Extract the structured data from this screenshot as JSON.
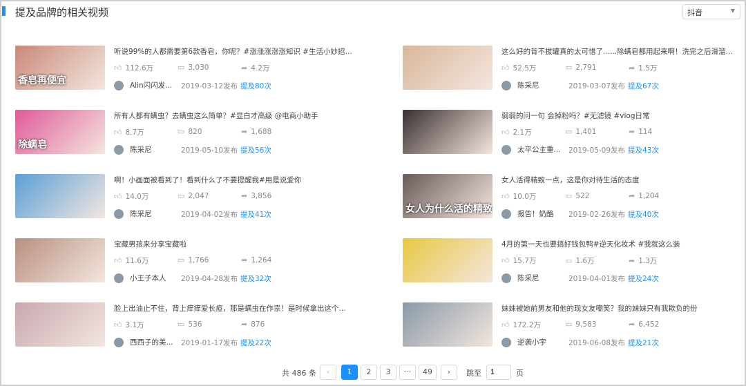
{
  "header": {
    "title": "提及品牌的相关视频",
    "platform": "抖音"
  },
  "videos": [
    {
      "title": "听说99%的人都需要第6款香皂，你呢？#涨涨涨涨涨知识 #生活小妙招 ...",
      "likes": "112.6万",
      "comments": "3,030",
      "shares": "4.2万",
      "author": "Alin闪闪发...",
      "date": "2019-03-12发布",
      "mentions": "提及80次",
      "caption": "香皂再便宜",
      "color": "#c9897a"
    },
    {
      "title": "这么好的背不拔罐真的太可惜了......除螨皂都用起来啊！洗完之后滑溜溜...",
      "likes": "52.5万",
      "comments": "2,791",
      "shares": "1.5万",
      "author": "陈采尼",
      "date": "2019-03-07发布",
      "mentions": "提及67次",
      "caption": "",
      "color": "#d8b79a"
    },
    {
      "title": "所有人都有螨虫？去螨虫这么简单？#显白才高级 @电商小助手",
      "likes": "8.7万",
      "comments": "820",
      "shares": "1,688",
      "author": "陈采尼",
      "date": "2019-05-10发布",
      "mentions": "提及56次",
      "caption": "除螨皂",
      "color": "#e05a9a"
    },
    {
      "title": "弱弱的问一句 会掉粉吗？#无滤镜 #vlog日常",
      "likes": "2.1万",
      "comments": "1,401",
      "shares": "114",
      "author": "太平公主重...",
      "date": "2019-05-09发布",
      "mentions": "提及43次",
      "caption": "",
      "color": "#3a3030"
    },
    {
      "title": "啊！小画面被看到了！看到什么了不要提醒我#用是说爱你",
      "likes": "14.0万",
      "comments": "2,047",
      "shares": "3,856",
      "author": "陈采尼",
      "date": "2019-04-02发布",
      "mentions": "提及41次",
      "caption": "",
      "color": "#5aa0d8"
    },
    {
      "title": "女人活得精致一点，这是你对待生活的态度",
      "likes": "10.0万",
      "comments": "522",
      "shares": "1,204",
      "author": "报告！奶酪",
      "date": "2019-02-26发布",
      "mentions": "提及40次",
      "caption": "女人为什么活的精致",
      "color": "#6a5a58"
    },
    {
      "title": "宝藏男孩来分享宝藏啦",
      "likes": "11.6万",
      "comments": "1,766",
      "shares": "1,264",
      "author": "小王子本人",
      "date": "2019-04-28发布",
      "mentions": "提及32次",
      "caption": "",
      "color": "#b89080"
    },
    {
      "title": "4月的第一天也要捂好钱包鸭#逆天化妆术 #我就这么装",
      "likes": "15.7万",
      "comments": "1.6万",
      "shares": "1.3万",
      "author": "陈采尼",
      "date": "2019-04-01发布",
      "mentions": "提及24次",
      "caption": "",
      "color": "#e8c840"
    },
    {
      "title": "脸上出油止不住，背上痒痒爱长痘，那是螨虫在作祟！是时候拿出这个...",
      "likes": "3.1万",
      "comments": "536",
      "shares": "876",
      "author": "西西子的美...",
      "date": "2019-01-17发布",
      "mentions": "提及22次",
      "caption": "",
      "color": "#c8a8b0"
    },
    {
      "title": "妹妹被她前男友和他的现女友嘲笑？我的妹妹只有我欺负的份",
      "likes": "172.2万",
      "comments": "9,583",
      "shares": "6,452",
      "author": "逆袭小宇",
      "date": "2019-06-08发布",
      "mentions": "提及21次",
      "caption": "",
      "color": "#8a9aa8"
    }
  ],
  "pagination": {
    "total": "共 486 条",
    "pages": [
      "1",
      "2",
      "3",
      "···",
      "49"
    ],
    "jump_label": "跳至",
    "jump_value": "1",
    "page_unit": "页",
    "prev": "‹",
    "next": "›"
  }
}
